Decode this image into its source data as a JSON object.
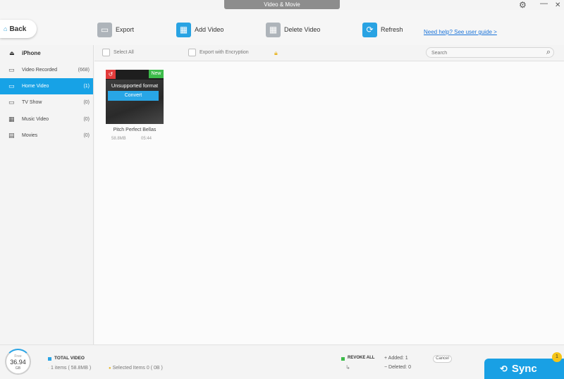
{
  "window": {
    "title": "Video & Movie"
  },
  "toolbar": {
    "back_label": "Back",
    "export_label": "Export",
    "add_label": "Add Video",
    "delete_label": "Delete Video",
    "refresh_label": "Refresh",
    "help_link": "Need help? See user guide >"
  },
  "sidebar": {
    "device": "iPhone",
    "items": [
      {
        "label": "Video Recorded",
        "count": "(668)"
      },
      {
        "label": "Home Video",
        "count": "(1)"
      },
      {
        "label": "TV Show",
        "count": "(0)"
      },
      {
        "label": "Music Video",
        "count": "(0)"
      },
      {
        "label": "Movies",
        "count": "(0)"
      }
    ]
  },
  "content_head": {
    "select_all": "Select All",
    "export_encryption": "Export with Encryption",
    "search_placeholder": "Search"
  },
  "video": {
    "badge_new": "New",
    "unsupported": "Unsupported format",
    "convert": "Convert",
    "name": "Pitch Perfect Bellas",
    "size": "58.8MB",
    "duration": "05:44"
  },
  "footer": {
    "free_label": "Free",
    "free_value": "36.94",
    "free_unit": "GB",
    "total_title": "TOTAL VIDEO",
    "items_text": "1 items ( 58.8MB )",
    "selected_text": "Selected Items 0 ( 0B )",
    "revoke": "REVOKE ALL",
    "added": "Added: 1",
    "deleted": "Deleted: 0",
    "cancel": "Cancel",
    "sync": "Sync",
    "sync_badge": "1"
  },
  "colors": {
    "accent": "#17a2e6",
    "new": "#3dbb4a",
    "undo": "#e23b3b",
    "badge": "#f5c518"
  }
}
